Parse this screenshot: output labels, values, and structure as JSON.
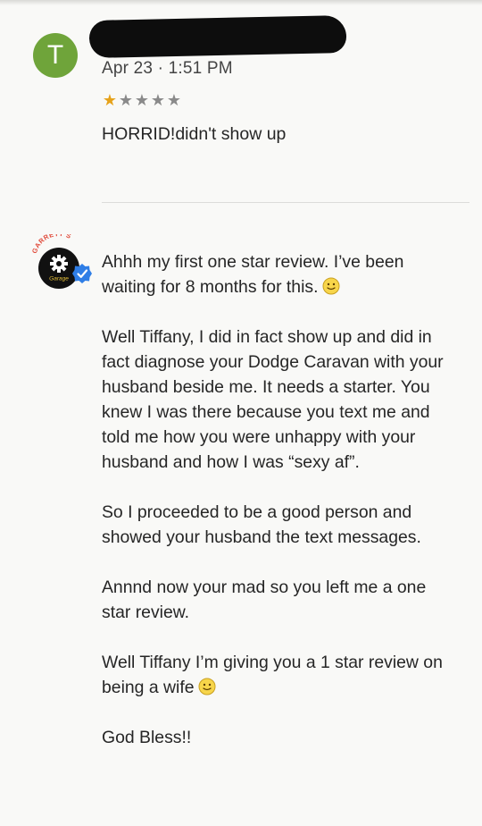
{
  "review": {
    "avatar_letter": "T",
    "date": "Apr 23 · 1:51 PM",
    "rating": 1,
    "rating_max": 5,
    "text": "HORRID!didn't show up"
  },
  "reply": {
    "logo": {
      "arc_text": "GARRETT'S",
      "badge_text": "Garage"
    },
    "paragraphs": [
      "Ahhh my first one star review. I’ve been waiting for 8 months for this.",
      "Well Tiffany, I did in fact show up and did in fact diagnose your Dodge Caravan with your husband beside me. It needs a starter. You knew I was there because you text me and told me how you were unhappy with your husband and how I was “sexy af”.",
      "So I proceeded to be a good person and showed your husband the text messages.",
      "Annnd now your mad so you left me a one star review.",
      "Well Tiffany I’m giving you a 1 star review on being a wife",
      "God Bless!!"
    ]
  },
  "icons": {
    "verified": "verified-check-icon",
    "emoji": "smiling-face-emoji-icon",
    "gear": "gear-icon"
  },
  "colors": {
    "avatar_bg": "#6fa43a",
    "star_filled": "#e6a21a",
    "star_empty": "#8a8a8a",
    "verified": "#2f7ee6"
  }
}
